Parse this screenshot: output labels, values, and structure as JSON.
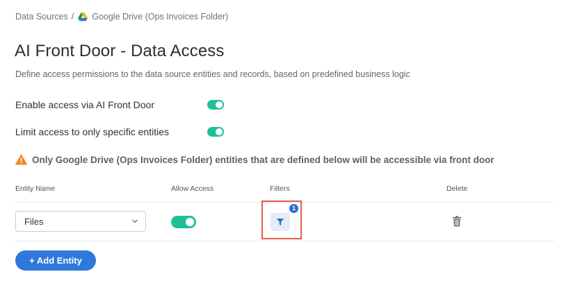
{
  "breadcrumb": {
    "root": "Data Sources",
    "separator": "/",
    "current": "Google Drive (Ops Invoices Folder)",
    "current_icon": "google-drive-icon"
  },
  "page": {
    "title": "AI Front Door - Data Access",
    "subtitle": "Define access permissions to the data source entities and records, based on predefined business logic"
  },
  "settings": {
    "enable_access": {
      "label": "Enable access via AI Front Door",
      "enabled": true
    },
    "limit_access": {
      "label": "Limit access to only specific entities",
      "enabled": true
    }
  },
  "warning": {
    "icon": "warning-icon",
    "text": "Only Google Drive (Ops Invoices Folder) entities that are defined below will be accessible via front door"
  },
  "table": {
    "columns": [
      "Entity Name",
      "Allow Access",
      "Filters",
      "Delete"
    ],
    "rows": [
      {
        "entity": "Files",
        "allow_access": true,
        "filter_count": "1",
        "filter_icon": "filter-icon",
        "delete_icon": "trash-icon"
      }
    ]
  },
  "actions": {
    "add_entity_label": "+ Add Entity"
  },
  "colors": {
    "toggle_on": "#1fbf9c",
    "primary": "#2f78dc",
    "badge": "#2a6fd6",
    "highlight": "#e8584c",
    "warning": "#f08a24"
  }
}
